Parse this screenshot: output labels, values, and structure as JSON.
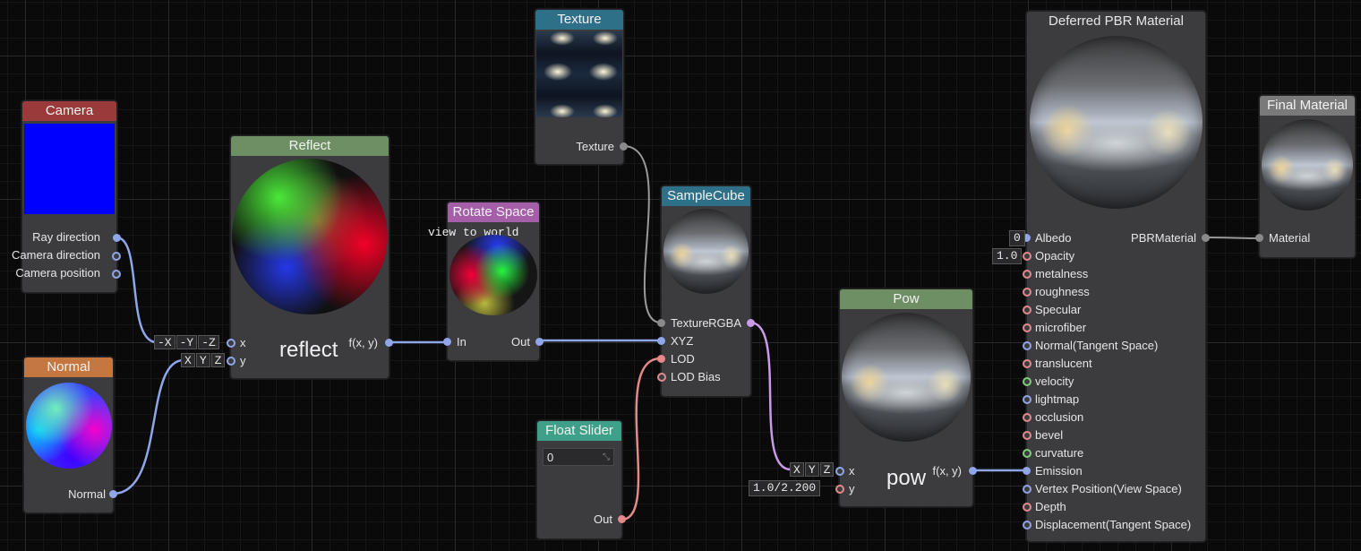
{
  "colors": {
    "camera": "#9a3a3a",
    "normal": "#c4773e",
    "reflect": "#6d8f63",
    "rotate": "#a55ea8",
    "texture": "#2f7089",
    "slider": "#3fa089",
    "final": "#7a7a7a",
    "wire_blue": "#8fa6e8",
    "wire_grey": "#9a9a9a",
    "wire_red": "#e58a8a",
    "wire_purple": "#c99ae8"
  },
  "nodes": {
    "camera": {
      "title": "Camera",
      "outputs": [
        "Ray direction",
        "Camera direction",
        "Camera position"
      ]
    },
    "normal": {
      "title": "Normal",
      "outputs": [
        "Normal"
      ]
    },
    "reflect": {
      "title": "Reflect",
      "func": "reflect",
      "output": "f(x, y)",
      "inputs": [
        {
          "label": "x",
          "swizzle": [
            "-X",
            "-Y",
            "-Z"
          ]
        },
        {
          "label": "y",
          "swizzle": [
            "X",
            "Y",
            "Z"
          ]
        }
      ]
    },
    "rotate": {
      "title": "Rotate Space",
      "caption": "view to world",
      "input": "In",
      "output": "Out"
    },
    "texture": {
      "title": "Texture",
      "output": "Texture"
    },
    "samplecube": {
      "title": "SampleCube",
      "inputs": [
        "Texture",
        "XYZ",
        "LOD",
        "LOD Bias"
      ],
      "output": "RGBA"
    },
    "slider": {
      "title": "Float Slider",
      "value": "0",
      "output": "Out"
    },
    "pow": {
      "title": "Pow",
      "func": "pow",
      "output": "f(x, y)",
      "inputs": [
        {
          "label": "x",
          "swizzle": [
            "X",
            "Y",
            "Z"
          ]
        },
        {
          "label": "y",
          "value": "1.0/2.200"
        }
      ]
    },
    "pbr": {
      "title": "Deferred PBR Material",
      "output": "PBRMaterial",
      "albedo_value": "0",
      "opacity_value": "1.0",
      "inputs": [
        "Albedo",
        "Opacity",
        "metalness",
        "roughness",
        "Specular",
        "microfiber",
        "Normal(Tangent Space)",
        "translucent",
        "velocity",
        "lightmap",
        "occlusion",
        "bevel",
        "curvature",
        "Emission",
        "Vertex Position(View Space)",
        "Depth",
        "Displacement(Tangent Space)"
      ]
    },
    "final": {
      "title": "Final Material",
      "input": "Material"
    }
  }
}
